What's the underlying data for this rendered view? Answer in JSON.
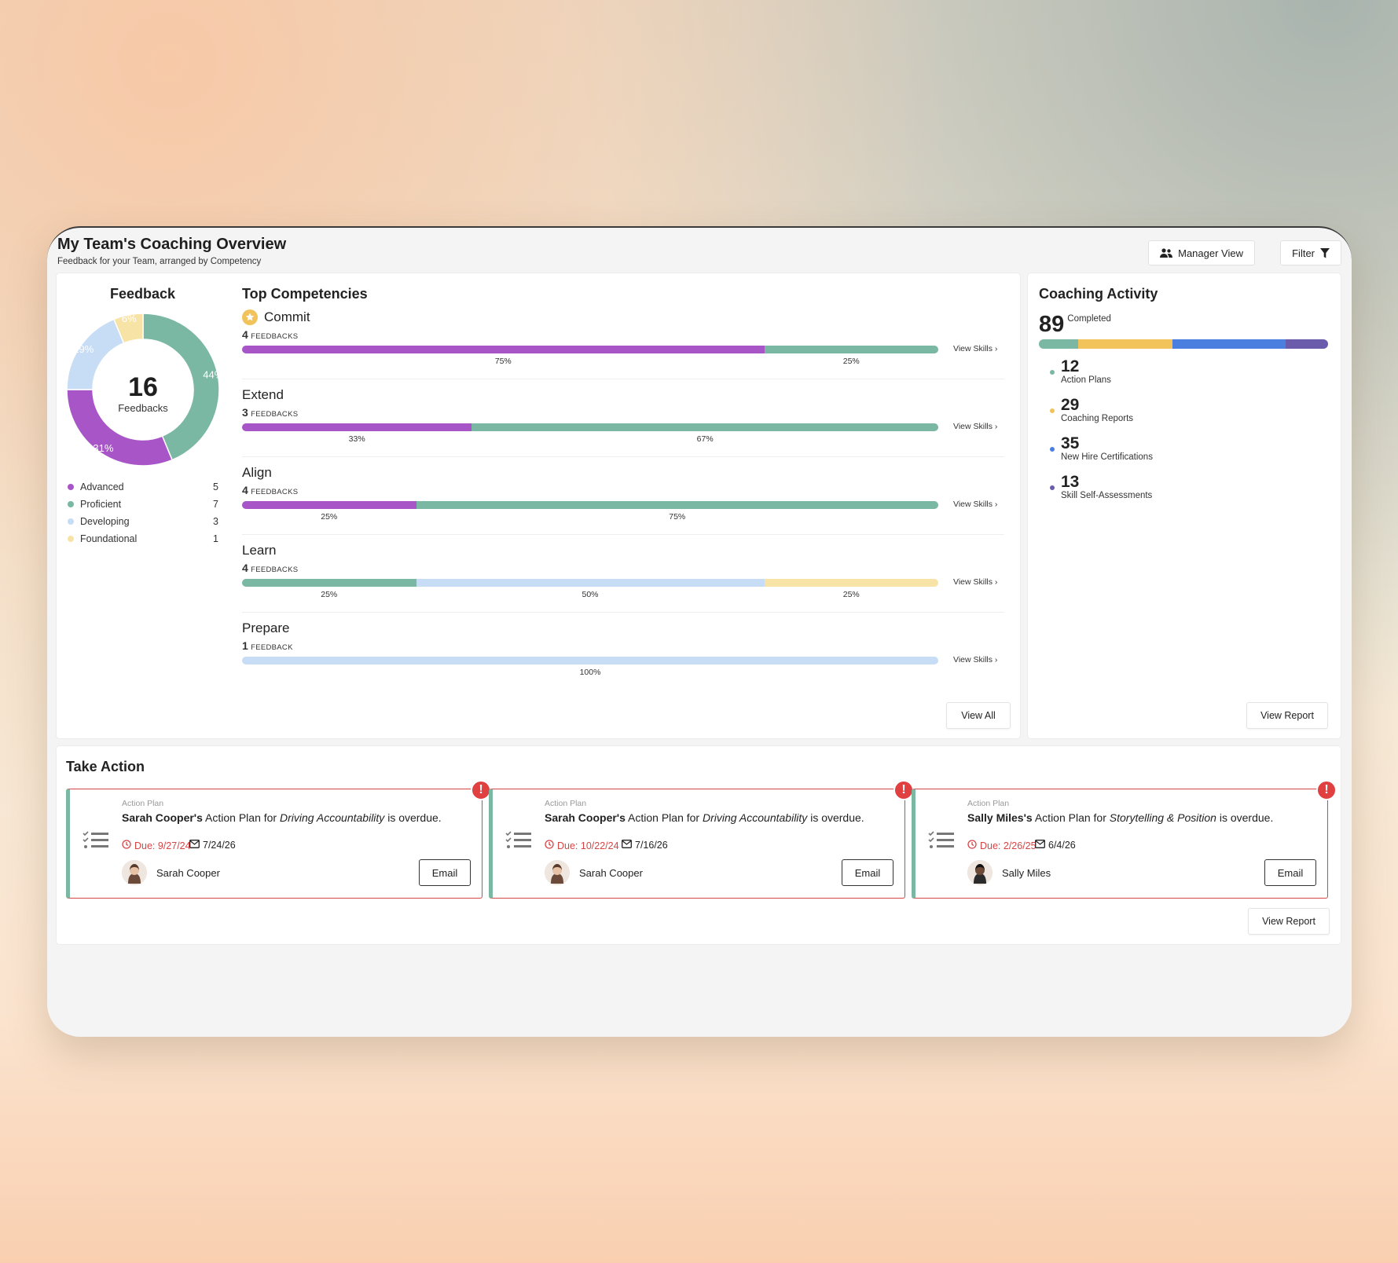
{
  "header": {
    "title": "My Team's Coaching Overview",
    "subtitle": "Feedback for your Team, arranged by Competency",
    "manager_view_label": "Manager View",
    "filter_label": "Filter"
  },
  "feedback": {
    "title": "Feedback",
    "total": "16",
    "total_label": "Feedbacks",
    "legend": [
      {
        "label": "Advanced",
        "count": "5",
        "color": "#a855c8"
      },
      {
        "label": "Proficient",
        "count": "7",
        "color": "#7ab8a3"
      },
      {
        "label": "Developing",
        "count": "3",
        "color": "#c7dcf5"
      },
      {
        "label": "Foundational",
        "count": "1",
        "color": "#f8e3a6"
      }
    ],
    "donut_labels": [
      "44%",
      "31%",
      "19%",
      "6%"
    ]
  },
  "chart_data": {
    "type": "pie",
    "title": "Feedback",
    "categories": [
      "Proficient",
      "Advanced",
      "Developing",
      "Foundational"
    ],
    "values": [
      7,
      5,
      3,
      1
    ],
    "percent_labels": [
      "44%",
      "31%",
      "19%",
      "6%"
    ],
    "colors": [
      "#7ab8a3",
      "#a855c8",
      "#c7dcf5",
      "#f8e3a6"
    ]
  },
  "competencies": {
    "title": "Top Competencies",
    "view_skills_label": "View Skills",
    "items": [
      {
        "name": "Commit",
        "count": "4",
        "unit": "FEEDBACKS",
        "segments": [
          {
            "value": 75,
            "color": "#a855c8",
            "label": "75%"
          },
          {
            "value": 25,
            "color": "#7ab8a3",
            "label": "25%"
          }
        ]
      },
      {
        "name": "Extend",
        "count": "3",
        "unit": "FEEDBACKS",
        "segments": [
          {
            "value": 33,
            "color": "#a855c8",
            "label": "33%"
          },
          {
            "value": 67,
            "color": "#7ab8a3",
            "label": "67%"
          }
        ]
      },
      {
        "name": "Align",
        "count": "4",
        "unit": "FEEDBACKS",
        "segments": [
          {
            "value": 25,
            "color": "#a855c8",
            "label": "25%"
          },
          {
            "value": 75,
            "color": "#7ab8a3",
            "label": "75%"
          }
        ]
      },
      {
        "name": "Learn",
        "count": "4",
        "unit": "FEEDBACKS",
        "segments": [
          {
            "value": 25,
            "color": "#7ab8a3",
            "label": "25%"
          },
          {
            "value": 50,
            "color": "#c7dcf5",
            "label": "50%"
          },
          {
            "value": 25,
            "color": "#f8e3a6",
            "label": "25%"
          }
        ]
      },
      {
        "name": "Prepare",
        "count": "1",
        "unit": "FEEDBACK",
        "segments": [
          {
            "value": 100,
            "color": "#c7dcf5",
            "label": "100%"
          }
        ]
      }
    ],
    "view_all_label": "View All"
  },
  "coaching": {
    "title": "Coaching Activity",
    "completed": "89",
    "completed_label": "Completed",
    "stats": [
      {
        "num": "12",
        "label": "Action Plans",
        "color": "#7ab8a3"
      },
      {
        "num": "29",
        "label": "Coaching Reports",
        "color": "#f1c35a"
      },
      {
        "num": "35",
        "label": "New Hire Certifications",
        "color": "#4a7fe0"
      },
      {
        "num": "13",
        "label": "Skill Self-Assessments",
        "color": "#6a5bab"
      }
    ],
    "view_report_label": "View Report"
  },
  "take_action": {
    "title": "Take Action",
    "cards": [
      {
        "type": "Action Plan",
        "person": "Sarah Cooper's",
        "mid": " Action Plan for ",
        "topic": "Driving Accountability",
        "tail": " is overdue.",
        "due": "Due: 9/27/24",
        "sent": "7/24/26",
        "name": "Sarah Cooper",
        "email_label": "Email"
      },
      {
        "type": "Action Plan",
        "person": "Sarah Cooper's",
        "mid": " Action Plan for ",
        "topic": "Driving Accountability",
        "tail": " is overdue.",
        "due": "Due: 10/22/24",
        "sent": "7/16/26",
        "name": "Sarah Cooper",
        "email_label": "Email"
      },
      {
        "type": "Action Plan",
        "person": "Sally Miles's",
        "mid": " Action Plan for ",
        "topic": "Storytelling & Position",
        "tail": " is overdue.",
        "due": "Due: 2/26/25",
        "sent": "6/4/26",
        "name": "Sally Miles",
        "email_label": "Email"
      }
    ],
    "view_report_label": "View Report"
  }
}
